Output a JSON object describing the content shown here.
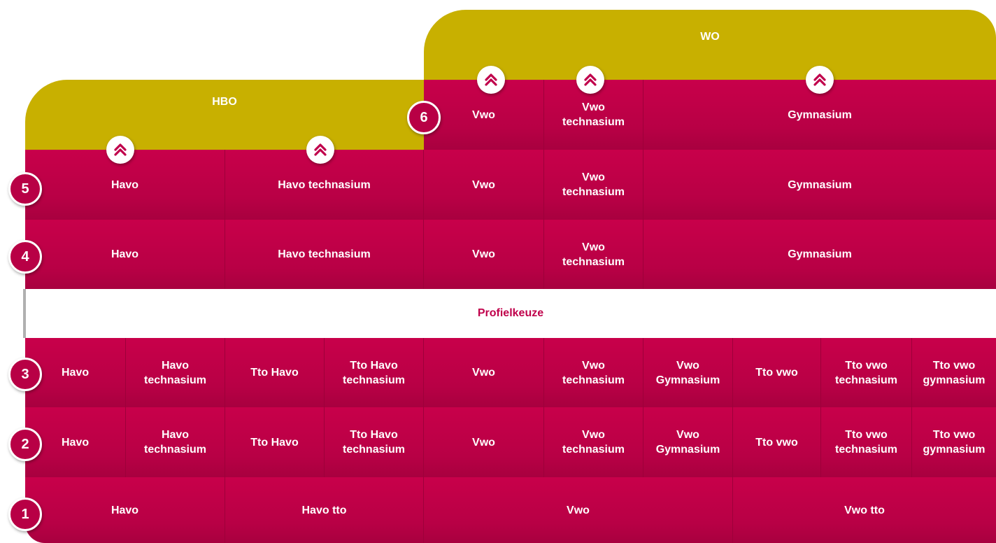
{
  "headers": {
    "hbo": "HBO",
    "wo": "WO"
  },
  "profielkeuze": "Profielkeuze",
  "levels": [
    "1",
    "2",
    "3",
    "4",
    "5",
    "6"
  ],
  "row6": [
    "Vwo",
    "Vwo technasium",
    "Gymnasium"
  ],
  "row5": [
    "Havo",
    "Havo technasium",
    "Vwo",
    "Vwo technasium",
    "Gymnasium"
  ],
  "row4": [
    "Havo",
    "Havo technasium",
    "Vwo",
    "Vwo technasium",
    "Gymnasium"
  ],
  "row3": [
    "Havo",
    "Havo technasium",
    "Tto Havo",
    "Tto Havo technasium",
    "Vwo",
    "Vwo technasium",
    "Vwo Gymnasium",
    "Tto vwo",
    "Tto vwo technasium",
    "Tto vwo gymnasium"
  ],
  "row2": [
    "Havo",
    "Havo technasium",
    "Tto Havo",
    "Tto Havo technasium",
    "Vwo",
    "Vwo technasium",
    "Vwo Gymnasium",
    "Tto vwo",
    "Tto vwo technasium",
    "Tto vwo gymnasium"
  ],
  "row1": [
    "Havo",
    "Havo tto",
    "Vwo",
    "Vwo tto"
  ],
  "colors": {
    "crimson": "#c0004b",
    "gold": "#c8b000"
  },
  "icon": "double-chevron-up-icon"
}
